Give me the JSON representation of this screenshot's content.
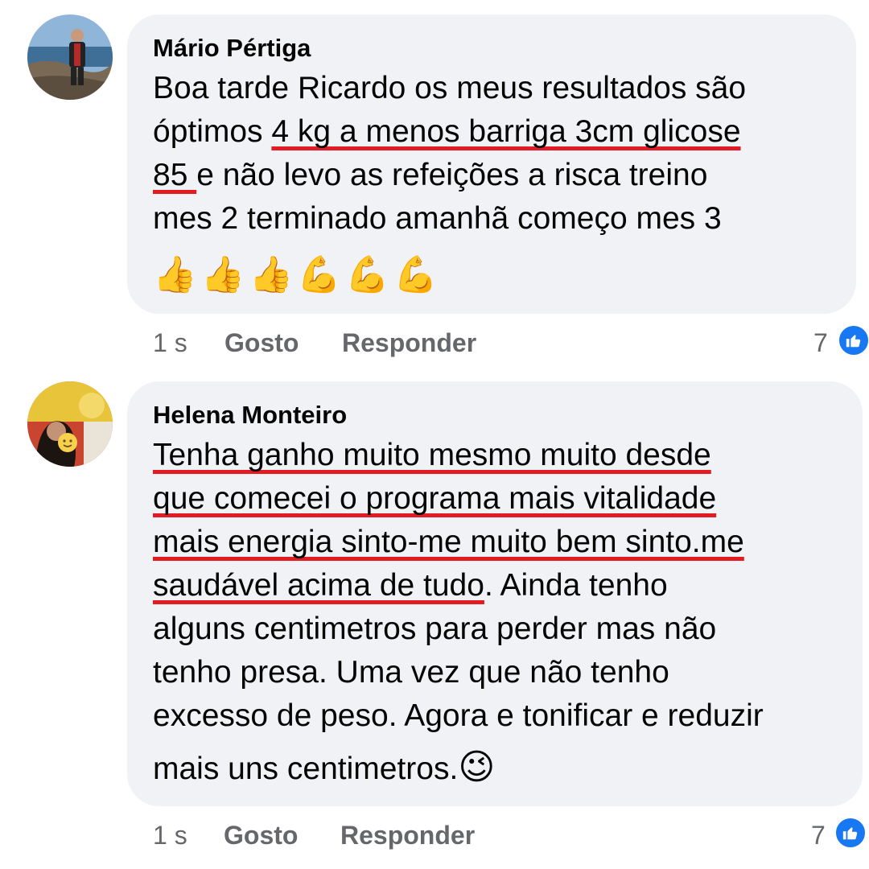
{
  "comments": [
    {
      "author": "Mário Pértiga",
      "lines": [
        [
          "Boa tarde Ricardo os meus resultados são",
          ""
        ],
        [
          "óptimos ",
          "4 kg a menos barriga 3cm  glicose"
        ],
        [
          "",
          "85 "
        ],
        [
          "mes 2 terminado amanhã  começo mes 3",
          ""
        ]
      ],
      "line3_tail": "e não levo as refeições a risca treino",
      "emojis": [
        "👍",
        "👍",
        "👍",
        "💪",
        "💪",
        "💪"
      ],
      "time": "1 s",
      "like_label": "Gosto",
      "reply_label": "Responder",
      "reaction_count": "7"
    },
    {
      "author": "Helena Monteiro",
      "underlined_lines": [
        "Tenha ganho muito mesmo muito desde",
        "que comecei  o programa mais vitalidade",
        "mais energia sinto-me  muito bem sinto.me",
        "saudável  acima de tudo"
      ],
      "line4_tail": ". Ainda tenho",
      "plain_lines": [
        "alguns  centimetros para perder mas não",
        "tenho presa. Uma vez que não  tenho",
        "excesso de peso. Agora e tonificar e reduzir",
        "mais uns centimetros."
      ],
      "end_emoji": "😉",
      "time": "1 s",
      "like_label": "Gosto",
      "reply_label": "Responder",
      "reaction_count": "7"
    }
  ],
  "colors": {
    "bubble": "#f0f2f5",
    "underline": "#e31b23",
    "like_blue": "#1877f2",
    "meta_text": "#65676b"
  }
}
